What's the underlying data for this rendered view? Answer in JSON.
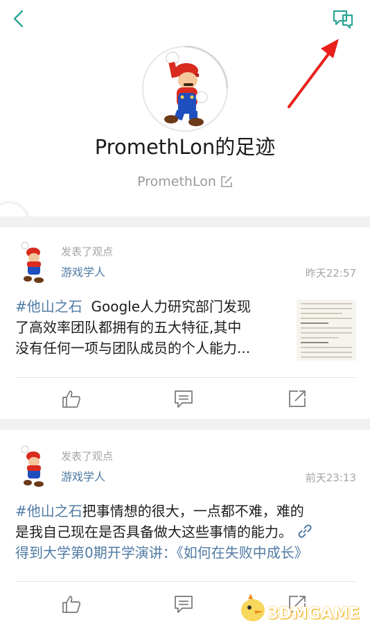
{
  "header": {
    "back_icon": "chevron-left-icon",
    "message_icon": "chat-bubble-icon",
    "accent": "#2ba597"
  },
  "annotation": {
    "arrow_color": "#e8201c"
  },
  "profile": {
    "title": "PromethLon的足迹",
    "username": "PromethLon",
    "edit_icon": "edit-icon"
  },
  "posts": [
    {
      "action": "发表了观点",
      "author": "游戏学人",
      "time": "昨天22:57",
      "tag": "#他山之石",
      "text_line1": "Google人力研究部门发现",
      "text_line2": "了高效率团队都拥有的五大特征,其中",
      "text_line3": "没有任何一项与团队成员的个人能力..."
    },
    {
      "action": "发表了观点",
      "author": "游戏学人",
      "time": "前天23:13",
      "tag": "#他山之石",
      "text_line1": "把事情想的很大，一点都不难，难的",
      "text_line2": "是我自己现在是否具备做大这些事情的能力。",
      "link_text": "得到大学第0期开学演讲：《如何在失败中成长》"
    }
  ],
  "watermark": {
    "text": "3DMGAME"
  }
}
